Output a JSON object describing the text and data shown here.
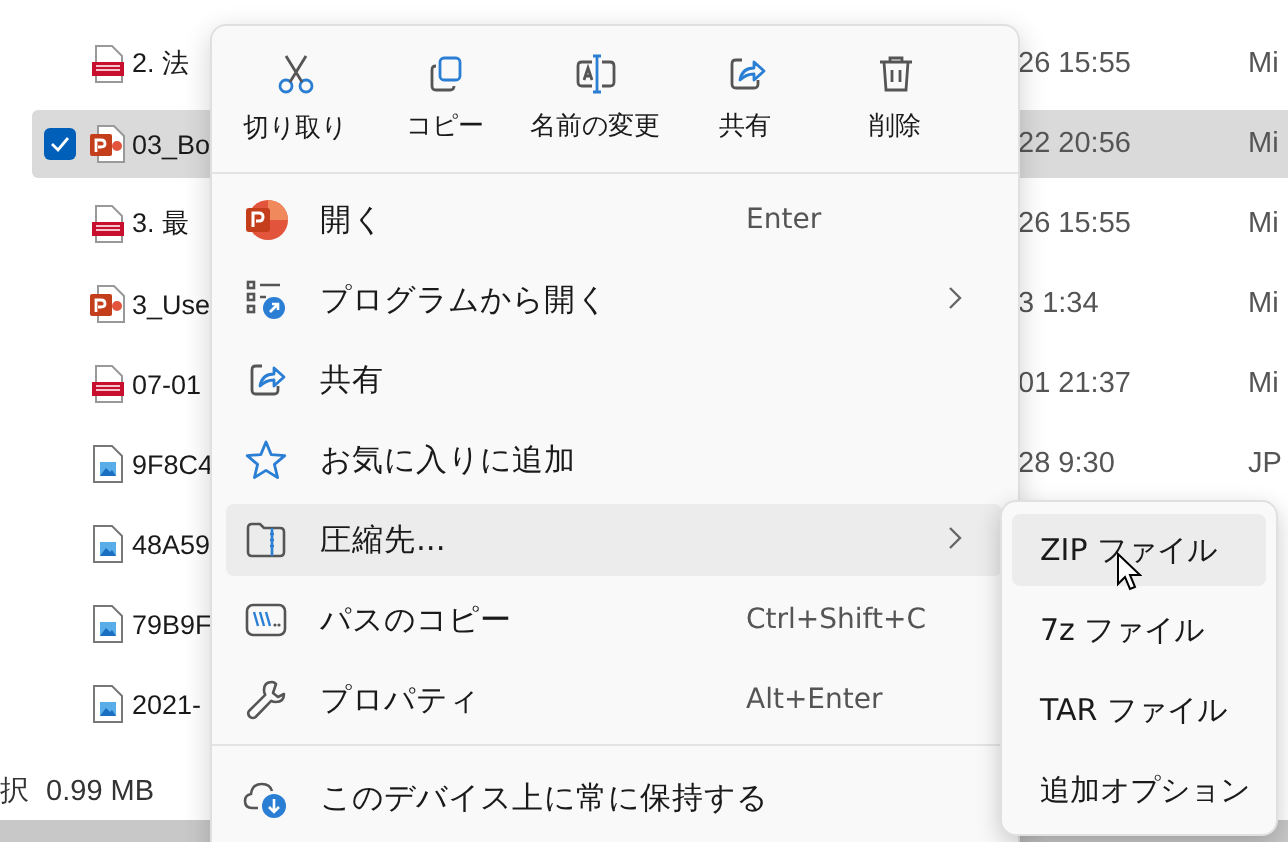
{
  "file_list": {
    "rows": [
      {
        "kind": "pdf",
        "name": "2. 法",
        "date": "26 15:55",
        "type": "Mi",
        "selected": false
      },
      {
        "kind": "pptx",
        "name": "03_Bo",
        "date": "22 20:56",
        "type": "Mi",
        "selected": true
      },
      {
        "kind": "pdf",
        "name": "3. 最",
        "date": "26 15:55",
        "type": "Mi",
        "selected": false
      },
      {
        "kind": "pptx",
        "name": "3_Use",
        "date": "3 1:34",
        "type": "Mi",
        "selected": false
      },
      {
        "kind": "pdf",
        "name": "07-01",
        "date": "01 21:37",
        "type": "Mi",
        "selected": false
      },
      {
        "kind": "image",
        "name": "9F8C4",
        "date": "28 9:30",
        "type": "JP",
        "selected": false
      },
      {
        "kind": "image",
        "name": "48A59",
        "selected": false
      },
      {
        "kind": "image",
        "name": "79B9F",
        "selected": false
      },
      {
        "kind": "image",
        "name": "2021-",
        "selected": false
      }
    ]
  },
  "status_bar": {
    "text": "択  0.99 MB"
  },
  "context_menu": {
    "toolbar": [
      {
        "label": "切り取り"
      },
      {
        "label": "コピー"
      },
      {
        "label": "名前の変更"
      },
      {
        "label": "共有"
      },
      {
        "label": "削除"
      }
    ],
    "items": [
      {
        "label": "開く",
        "shortcut": "Enter",
        "submenu": false,
        "highlighted": false
      },
      {
        "label": "プログラムから開く",
        "submenu": true,
        "highlighted": false
      },
      {
        "label": "共有",
        "submenu": false,
        "highlighted": false
      },
      {
        "label": "お気に入りに追加",
        "submenu": false,
        "highlighted": false
      },
      {
        "label": "圧縮先...",
        "submenu": true,
        "highlighted": true
      },
      {
        "label": "パスのコピー",
        "shortcut": "Ctrl+Shift+C",
        "submenu": false,
        "highlighted": false
      },
      {
        "label": "プロパティ",
        "shortcut": "Alt+Enter",
        "submenu": false,
        "highlighted": false
      },
      {
        "label": "このデバイス上に常に保持する",
        "submenu": false,
        "highlighted": false,
        "separator_before": true
      }
    ]
  },
  "submenu": {
    "items": [
      {
        "label": "ZIP ファイル",
        "highlighted": true
      },
      {
        "label": "7z ファイル",
        "highlighted": false
      },
      {
        "label": "TAR ファイル",
        "highlighted": false
      },
      {
        "label": "追加オプション",
        "highlighted": false
      }
    ]
  }
}
